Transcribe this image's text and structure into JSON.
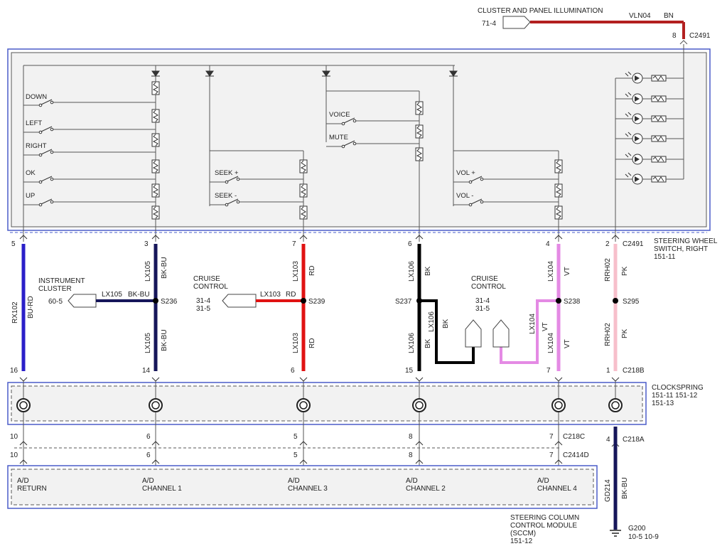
{
  "top": {
    "title": "CLUSTER AND PANEL ILLUMINATION",
    "ref": "71-4",
    "circuit": "VLN04",
    "color": "BN",
    "pin": "8",
    "connector": "C2491"
  },
  "switches": {
    "left": [
      "DOWN",
      "LEFT",
      "RIGHT",
      "OK",
      "UP"
    ],
    "seek": [
      "SEEK +",
      "SEEK -"
    ],
    "voice": [
      "VOICE",
      "MUTE"
    ],
    "vol": [
      "VOL +",
      "VOL -"
    ]
  },
  "steering_wheel": {
    "connector": "C2491",
    "label1": "STEERING WHEEL",
    "label2": "SWITCH, RIGHT",
    "ref": "151-11"
  },
  "pins_top": [
    "5",
    "3",
    "7",
    "6",
    "4",
    "2"
  ],
  "pins_c218b": [
    "16",
    "14",
    "6",
    "15",
    "7",
    "1"
  ],
  "c218b": "C218B",
  "wires": {
    "rx102": {
      "circuit": "RX102",
      "color": "BU-RD"
    },
    "lx105_top": {
      "circuit": "LX105",
      "color": "BK-BU"
    },
    "lx105_bot": {
      "circuit": "LX105",
      "color": "BK-BU"
    },
    "lx103_top": {
      "circuit": "LX103",
      "color": "RD"
    },
    "lx103_bot": {
      "circuit": "LX103",
      "color": "RD"
    },
    "lx106_top": {
      "circuit": "LX106",
      "color": "BK"
    },
    "lx106_bot": {
      "circuit": "LX106",
      "color": "BK"
    },
    "lx106_branch": {
      "circuit": "LX106",
      "color": "BK"
    },
    "lx104_top": {
      "circuit": "LX104",
      "color": "VT"
    },
    "lx104_bot": {
      "circuit": "LX104",
      "color": "VT"
    },
    "lx104_branch": {
      "circuit": "LX104",
      "color": "VT"
    },
    "rrh02_top": {
      "circuit": "RRH02",
      "color": "PK"
    },
    "rrh02_bot": {
      "circuit": "RRH02",
      "color": "PK"
    },
    "gd214": {
      "circuit": "GD214",
      "color": "BK-BU"
    }
  },
  "splices": [
    "S236",
    "S239",
    "S237",
    "S238",
    "S295"
  ],
  "instrument_cluster": {
    "label1": "INSTRUMENT",
    "label2": "CLUSTER",
    "ref": "60-5",
    "circuit": "LX105",
    "color": "BK-BU"
  },
  "cruise_left": {
    "label1": "CRUISE",
    "label2": "CONTROL",
    "ref1": "31-4",
    "ref2": "31-5",
    "circuit": "LX103",
    "color": "RD"
  },
  "cruise_right": {
    "label1": "CRUISE",
    "label2": "CONTROL",
    "ref1": "31-4",
    "ref2": "31-5"
  },
  "clockspring": {
    "label": "CLOCKSPRING",
    "refs1": "151-11   151-12",
    "refs2": "151-13"
  },
  "c218c": {
    "connector": "C218C",
    "pins": [
      "10",
      "6",
      "5",
      "8",
      "7"
    ]
  },
  "c2414d": {
    "connector": "C2414D",
    "pins": [
      "10",
      "6",
      "5",
      "8",
      "7"
    ]
  },
  "c218a": {
    "connector": "C218A",
    "pin": "4"
  },
  "sccm": {
    "inputs": [
      {
        "l1": "A/D",
        "l2": "RETURN"
      },
      {
        "l1": "A/D",
        "l2": "CHANNEL 1"
      },
      {
        "l1": "A/D",
        "l2": "CHANNEL 3"
      },
      {
        "l1": "A/D",
        "l2": "CHANNEL 2"
      },
      {
        "l1": "A/D",
        "l2": "CHANNEL 4"
      }
    ],
    "label1": "STEERING COLUMN",
    "label2": "CONTROL MODULE",
    "label3": "(SCCM)",
    "ref": "151-12"
  },
  "ground": {
    "label": "G200",
    "refs": "10-5    10-9"
  },
  "colors": {
    "blue": "#2a1fc9",
    "navy": "#16165a",
    "red": "#e01212",
    "black": "#000000",
    "violet": "#e48ae4",
    "pink": "#f7bfcb",
    "brown": "#b32020",
    "frame": "#4a5cc8"
  }
}
